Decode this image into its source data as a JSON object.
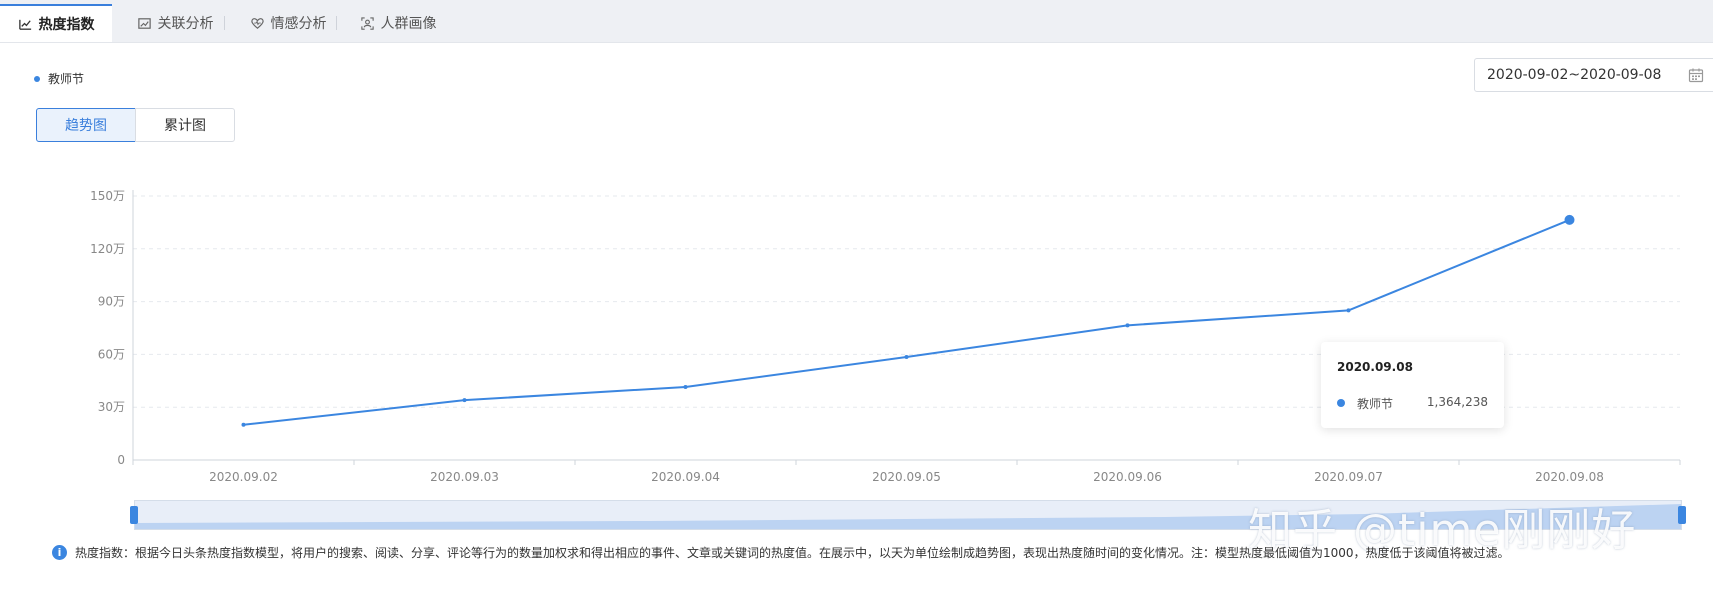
{
  "tabs": [
    {
      "label": "热度指数",
      "icon": "trend-chart-icon",
      "active": true
    },
    {
      "label": "关联分析",
      "icon": "image-chart-icon",
      "active": false
    },
    {
      "label": "情感分析",
      "icon": "heart-icon",
      "active": false
    },
    {
      "label": "人群画像",
      "icon": "person-scan-icon",
      "active": false
    }
  ],
  "legend": {
    "label": "教师节"
  },
  "date_range": {
    "value": "2020-09-02~2020-09-08"
  },
  "view_toggle": {
    "trend_label": "趋势图",
    "cumulative_label": "累计图",
    "selected": "trend"
  },
  "tooltip": {
    "title": "2020.09.08",
    "series_name": "教师节",
    "value": "1,364,238"
  },
  "watermark": "知乎 @time刚刚好",
  "note": "热度指数：根据今日头条热度指数模型，将用户的搜索、阅读、分享、评论等行为的数量加权求和得出相应的事件、文章或关键词的热度值。在展示中，以天为单位绘制成趋势图，表现出热度随时间的变化情况。注：模型热度最低阈值为1000，热度低于该阈值将被过滤。",
  "colors": {
    "accent": "#3b86e0",
    "grid": "#e6e9ee",
    "axis": "#cfd4db"
  },
  "chart_data": {
    "type": "line",
    "x": [
      "2020.09.02",
      "2020.09.03",
      "2020.09.04",
      "2020.09.05",
      "2020.09.06",
      "2020.09.07",
      "2020.09.08"
    ],
    "series": [
      {
        "name": "教师节",
        "values": [
          200000,
          340000,
          415000,
          585000,
          765000,
          850000,
          1364238
        ]
      }
    ],
    "y_ticks": [
      0,
      300000,
      600000,
      900000,
      1200000,
      1500000
    ],
    "y_tick_labels": [
      "0",
      "30万",
      "60万",
      "90万",
      "120万",
      "150万"
    ],
    "ylim": [
      0,
      1500000
    ],
    "grid": true,
    "legend": "top-left",
    "highlighted_index": 6
  }
}
